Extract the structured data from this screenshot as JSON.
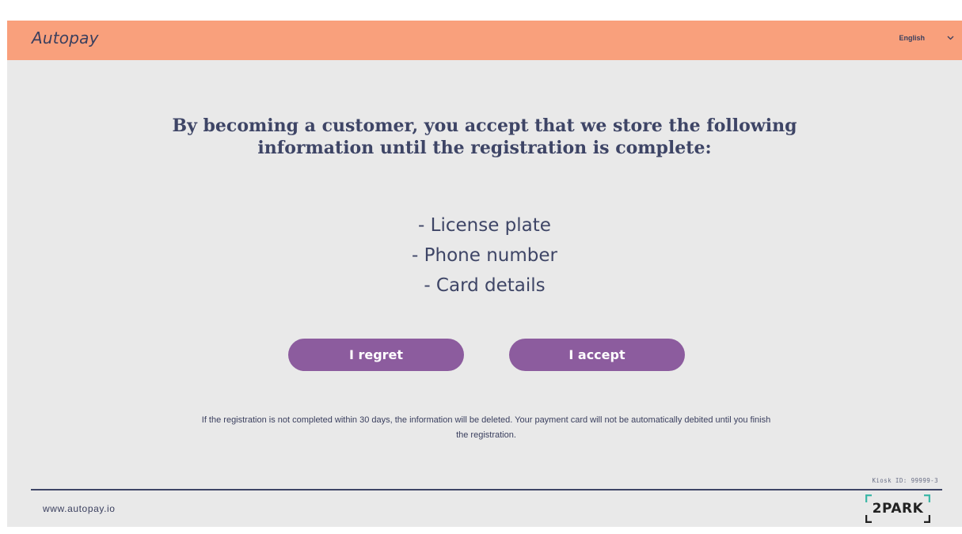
{
  "header": {
    "brand": "Autopay",
    "language": "English",
    "accent_color": "#f9a07c"
  },
  "main": {
    "heading_line1": "By becoming a customer, you accept that we store the following",
    "heading_line2": "information until the registration is complete:",
    "items": [
      "- License plate",
      "- Phone number",
      "- Card details"
    ],
    "buttons": {
      "regret_label": "I regret",
      "accept_label": "I accept",
      "button_color": "#8c5c9e"
    },
    "notice_line1": "If the registration is not completed within 30 days, the information will be deleted. Your payment card will not be automatically debited until you finish",
    "notice_line2": "the registration."
  },
  "footer": {
    "kiosk_id": "Kiosk ID: 99999-3",
    "website": "www.autopay.io",
    "partner_logo": "2PARK"
  },
  "icons": {
    "language_dropdown": "chevron-down-icon"
  }
}
